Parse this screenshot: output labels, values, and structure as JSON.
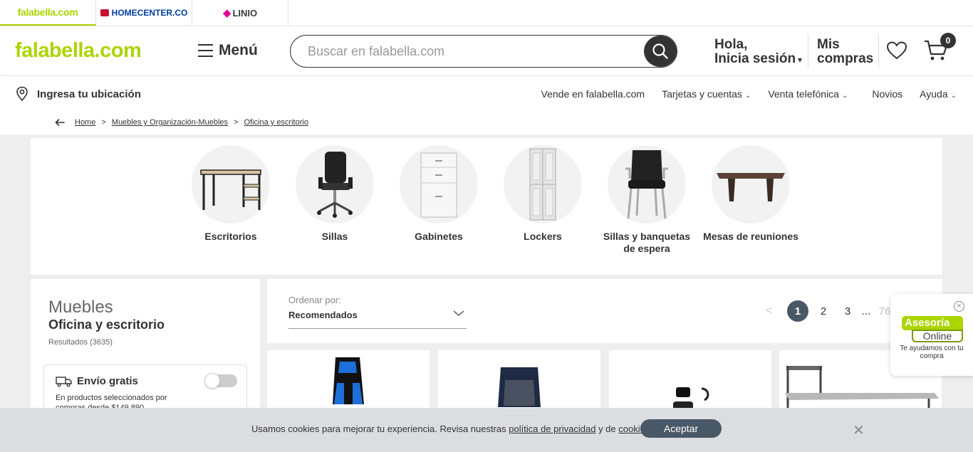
{
  "brands": {
    "falabella": "falabella.com",
    "homecenter": "HOMECENTER.CO",
    "linio": "LINIO"
  },
  "header": {
    "logo": "falabella.com",
    "menu_label": "Menú",
    "search_placeholder": "Buscar en falabella.com",
    "login_line1": "Hola,",
    "login_line2": "Inicia sesión",
    "purchases_line1": "Mis",
    "purchases_line2": "compras",
    "cart_count": "0"
  },
  "locbar": {
    "location_label": "Ingresa tu ubicación",
    "nav": [
      {
        "label": "Vende en falabella.com",
        "has_chevron": false
      },
      {
        "label": "Tarjetas y cuentas",
        "has_chevron": true
      },
      {
        "label": "Venta telefónica",
        "has_chevron": true
      },
      {
        "label": "Novios",
        "has_chevron": false
      },
      {
        "label": "Ayuda",
        "has_chevron": true
      }
    ]
  },
  "breadcrumb": {
    "back_icon": "arrow-left-icon",
    "items": [
      "Home",
      "Muebles y Organización-Muebles",
      "Oficina y escritorio"
    ],
    "separator": ">"
  },
  "categories": [
    {
      "label": "Escritorios",
      "icon": "desk-image"
    },
    {
      "label": "Sillas",
      "icon": "office-chair-image"
    },
    {
      "label": "Gabinetes",
      "icon": "file-cabinet-image"
    },
    {
      "label": "Lockers",
      "icon": "locker-image"
    },
    {
      "label": "Sillas y banquetas de espera",
      "icon": "waiting-chair-image"
    },
    {
      "label": "Mesas de reuniones",
      "icon": "meeting-table-image"
    }
  ],
  "sidebar": {
    "category": "Muebles",
    "subcategory": "Oficina y escritorio",
    "results": "Resultados (3635)",
    "shipping_title": "Envío gratis",
    "shipping_desc": "En productos seleccionados por compras desde $149.890",
    "shipping_enabled": false
  },
  "sort": {
    "label": "Ordenar por:",
    "value": "Recomendados"
  },
  "pagination": {
    "pages": [
      "1",
      "2",
      "3"
    ],
    "ellipsis": "...",
    "last": "76",
    "current": "1"
  },
  "chat": {
    "bubble_top": "Asesoría",
    "bubble_bottom": "Online",
    "text": "Te ayudamos con tu compra"
  },
  "cookie": {
    "text_before": "Usamos cookies para mejorar tu experiencia. Revisa nuestras",
    "privacy_link": "política de privacidad",
    "text_mid": "y de",
    "cookies_link": "cookies",
    "text_end": ".",
    "accept": "Aceptar"
  },
  "colors": {
    "brand_green": "#aad500",
    "dark": "#333333",
    "button_slate": "#495867"
  }
}
